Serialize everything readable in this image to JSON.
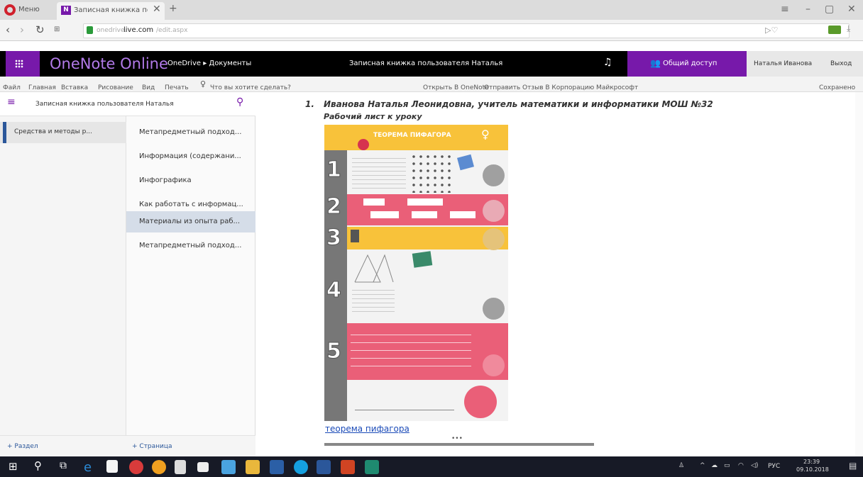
{
  "browser": {
    "menu_label": "Меню",
    "tab_title": "Записная книжка пользо",
    "tab_favicon": "N",
    "url_prefix": "onedrive.",
    "url_domain": "live.com",
    "url_suffix": "/edit.aspx"
  },
  "appbar": {
    "app_name": "OneNote Online",
    "breadcrumb": "OneDrive ▸ Документы",
    "notebook_title": "Записная книжка пользователя Наталья",
    "share_label": "Общий доступ",
    "user_name": "Наталья Иванова",
    "signout_label": "Выход"
  },
  "ribbon": {
    "tabs": [
      "Файл",
      "Главная",
      "Вставка",
      "Рисование",
      "Вид",
      "Печать"
    ],
    "tell_me": "Что вы хотите сделать?",
    "open_in_onenote": "Открыть В OneNote",
    "feedback": "Отправить Отзыв В Корпорацию Майкрософт",
    "saved": "Сохранено"
  },
  "notebook": {
    "title": "Записная книжка пользователя Наталья",
    "sections": [
      "Средства и методы р..."
    ],
    "pages": [
      "Метапредметный подход...",
      "Информация (содержани...",
      "Инфографика",
      "Как работать с информац...",
      "Материалы из опыта раб...",
      "Метапредметный подход..."
    ],
    "add_section": "+ Раздел",
    "add_page": "+ Страница"
  },
  "page": {
    "list_number": "1.",
    "heading_line1": "Иванова Наталья Леонидовна, учитель математики и информатики МОШ №32",
    "heading_line2": "Рабочий лист к уроку",
    "worksheet_title": "ТЕОРЕМА ПИФАГОРА",
    "worksheet_numbers": [
      "1",
      "2",
      "3",
      "4",
      "5"
    ],
    "link_text": "теорема пифагора",
    "resize_handle": "•••"
  },
  "taskbar": {
    "lang": "РУС",
    "time": "23:39",
    "date": "09.10.2018"
  },
  "colors": {
    "onenote_purple": "#7719aa",
    "appbar_black": "#000000",
    "worksheet_yellow": "#f8c23a",
    "worksheet_pink": "#ea5f78",
    "taskbar": "#171a26"
  }
}
